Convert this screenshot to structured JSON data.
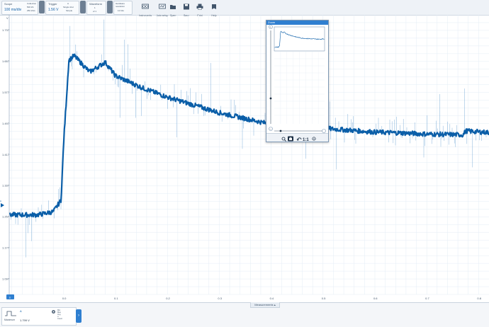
{
  "toolbar": {
    "scope": {
      "title": "Scope",
      "value": "100 ms/div",
      "collection_label": "Collection",
      "samples": "500 kS",
      "samples_sub": "250 kS/s"
    },
    "trigger": {
      "title": "Trigger",
      "value": "1.56 V",
      "channel": "A",
      "mode": "Single shot",
      "edge": "Simple"
    },
    "waveform": {
      "title": "Waveform",
      "value": "1",
      "of": "of 1"
    },
    "resolution": {
      "title": "Hardware resolution",
      "value": "12 bits"
    },
    "buttons": [
      {
        "label": "Instruments",
        "icon": "instruments-icon"
      },
      {
        "label": "Auto setup",
        "icon": "auto-setup-icon"
      },
      {
        "label": "Open",
        "icon": "open-icon"
      },
      {
        "label": "Save",
        "icon": "save-icon"
      },
      {
        "label": "Print",
        "icon": "print-icon"
      },
      {
        "label": "Help",
        "icon": "help-icon"
      }
    ]
  },
  "plot": {
    "y_unit": "V",
    "y_ticks": [
      "1.737",
      "1.657",
      "1.577",
      "1.497",
      "1.417",
      "1.337",
      "1.257",
      "1.177",
      "1.097"
    ],
    "x_ticks": [
      "0.0",
      "0.1",
      "0.2",
      "0.3",
      "0.4",
      "0.5",
      "0.6",
      "0.7",
      "0.8"
    ],
    "x_unit_badge": "s",
    "channel_badge": "A"
  },
  "zoom_panel": {
    "title": "Zoom",
    "ratio_label": "1:1",
    "plus": "+",
    "minus": "−"
  },
  "measurements": {
    "tab_label": "Measurements",
    "channel": "A",
    "name": "Maximum",
    "value": "1.799 V",
    "stats": [
      "Min",
      "Max",
      "Avg",
      "σ",
      "Count"
    ]
  },
  "colors": {
    "accent": "#2f7fd0",
    "trace": "#0a5ea8",
    "trace_spike": "#4d8fcc",
    "grid": "#e3ecf5"
  },
  "chart_data": {
    "type": "line",
    "series": [
      {
        "name": "A"
      }
    ],
    "x": [
      -0.105,
      -0.05,
      -0.02,
      -0.005,
      0.0,
      0.01,
      0.02,
      0.05,
      0.08,
      0.1,
      0.15,
      0.2,
      0.25,
      0.3,
      0.35,
      0.4,
      0.45,
      0.5,
      0.55,
      0.6,
      0.65,
      0.7,
      0.77,
      0.775,
      0.82
    ],
    "y": [
      1.262,
      1.262,
      1.27,
      1.3,
      1.45,
      1.66,
      1.672,
      1.63,
      1.655,
      1.62,
      1.59,
      1.565,
      1.545,
      1.525,
      1.51,
      1.495,
      1.49,
      1.485,
      1.48,
      1.475,
      1.473,
      1.47,
      1.468,
      1.478,
      1.474
    ],
    "xlim": [
      -0.105,
      0.82
    ],
    "ylim": [
      1.057,
      1.777
    ],
    "grid": true
  }
}
